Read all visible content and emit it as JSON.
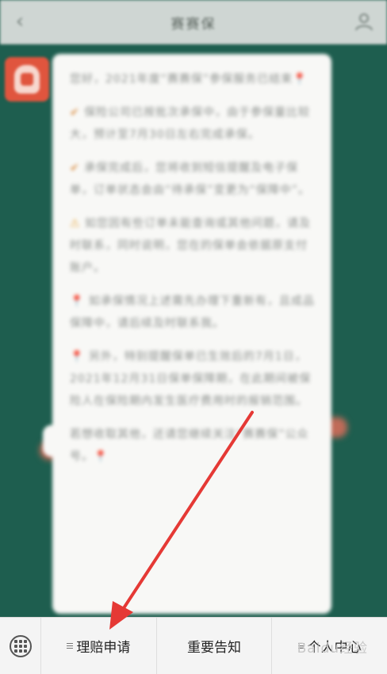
{
  "header": {
    "title": "赛赛保"
  },
  "chat": {
    "message_paragraphs": [
      {
        "lead": "",
        "text": "您好，2021年度“赛赛保”参保服务已结束"
      },
      {
        "lead": "✔",
        "text": "保险公司已按批次承保中，由于参保量比较大，预计至7月30日左右完成承保。"
      },
      {
        "lead": "✔",
        "text": "承保完成后，您将收到短信提醒及电子保单，订单状态会由“待承保”变更为“保障中”。"
      },
      {
        "lead": "⚠",
        "text": "如您因有些订单未能查询或其他问题，请及时联系，同时说明，您在的保单会依据原支付账户。"
      },
      {
        "lead": "📍",
        "text": "如承保情况上述需先办理下重新有，且成品保障中，请后续及时联系我。"
      },
      {
        "lead": "📍",
        "text": "另外，特别提醒保单已生效后的7月1日，2021年12月31日保单保障期，在此期间被保险人在保险期内发生医疗费用时的报销范围。"
      },
      {
        "lead": "",
        "text": "若想收取其他，还请您继续关注“赛赛保”公众号。"
      }
    ]
  },
  "bottom_menu": {
    "items": [
      {
        "label": "理赔申请"
      },
      {
        "label": "重要告知"
      },
      {
        "label": "个人中心"
      }
    ],
    "watermark": "Baidu经验"
  },
  "colors": {
    "chat_background": "#1e5e4f",
    "annotation_arrow": "#e53935",
    "avatar": "#e0553e"
  }
}
